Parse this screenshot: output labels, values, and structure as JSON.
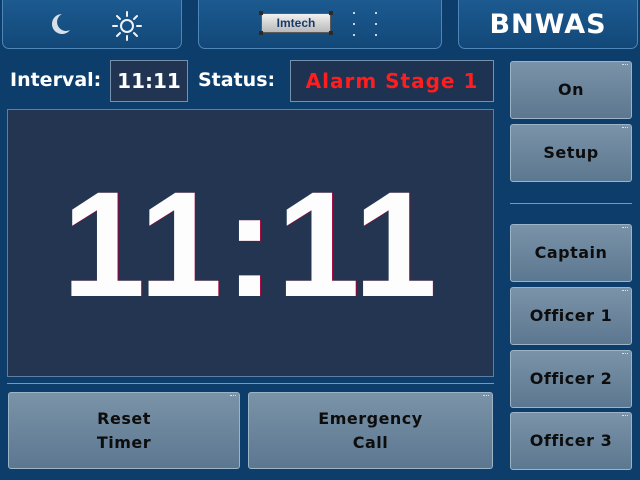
{
  "header": {
    "left": {
      "night_icon": "moon-icon",
      "day_icon": "sun-icon"
    },
    "center": {
      "logo_text": "Imtech",
      "dots_icon": "dots-grid-icon"
    },
    "right": {
      "title": "BNWAS"
    }
  },
  "status_bar": {
    "interval_label": "Interval:",
    "interval_value": "11:11",
    "status_label": "Status:",
    "status_value": "Alarm Stage 1",
    "status_color": "#ff1d1d"
  },
  "clock": {
    "display": "11:11"
  },
  "bottom_buttons": {
    "reset_label": "Reset\nTimer",
    "emergency_label": "Emergency\nCall"
  },
  "side_buttons": {
    "on_label": "On",
    "setup_label": "Setup",
    "captain_label": "Captain",
    "officer1_label": "Officer 1",
    "officer2_label": "Officer 2",
    "officer3_label": "Officer 3"
  },
  "colors": {
    "background": "#0d3d6b",
    "panel": "#1c5a90",
    "button": "#6f88a0",
    "clock_bg": "#233550",
    "alarm": "#ff1d1d"
  }
}
